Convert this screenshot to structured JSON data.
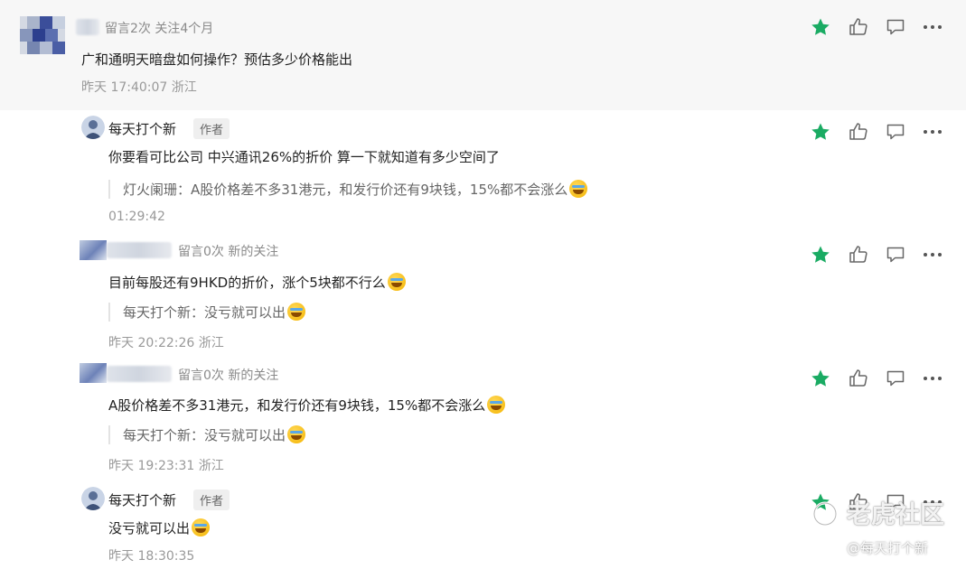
{
  "comments": [
    {
      "meta": "留言2次 关注4个月",
      "content": "广和通明天暗盘如何操作？预估多少价格能出",
      "time": "昨天 17:40:07 浙江"
    },
    {
      "name": "每天打个新",
      "tag": "作者",
      "content": "你要看可比公司 中兴通讯26%的折价 算一下就知道有多少空间了",
      "quote": "灯火阑珊：A股价格差不多31港元，和发行价还有9块钱，15%都不会涨么",
      "time": "01:29:42"
    },
    {
      "meta": "留言0次 新的关注",
      "content": "目前每股还有9HKD的折价，涨个5块都不行么",
      "quote": "每天打个新：没亏就可以出",
      "time": "昨天 20:22:26 浙江"
    },
    {
      "meta": "留言0次 新的关注",
      "content": "A股价格差不多31港元，和发行价还有9块钱，15%都不会涨么",
      "quote": "每天打个新：没亏就可以出",
      "time": "昨天 19:23:31 浙江"
    },
    {
      "name": "每天打个新",
      "tag": "作者",
      "content": "没亏就可以出",
      "time": "昨天 18:30:35"
    }
  ],
  "watermark": {
    "brand": "老虎社区",
    "handle": "@每天打个新"
  },
  "icons": [
    "star-icon",
    "like-icon",
    "comment-icon",
    "more-icon",
    "laugh-cry-emoji"
  ],
  "colors": {
    "star": "#1aab63",
    "icon_gray": "#666666",
    "top_bg": "#f7f7f7"
  }
}
